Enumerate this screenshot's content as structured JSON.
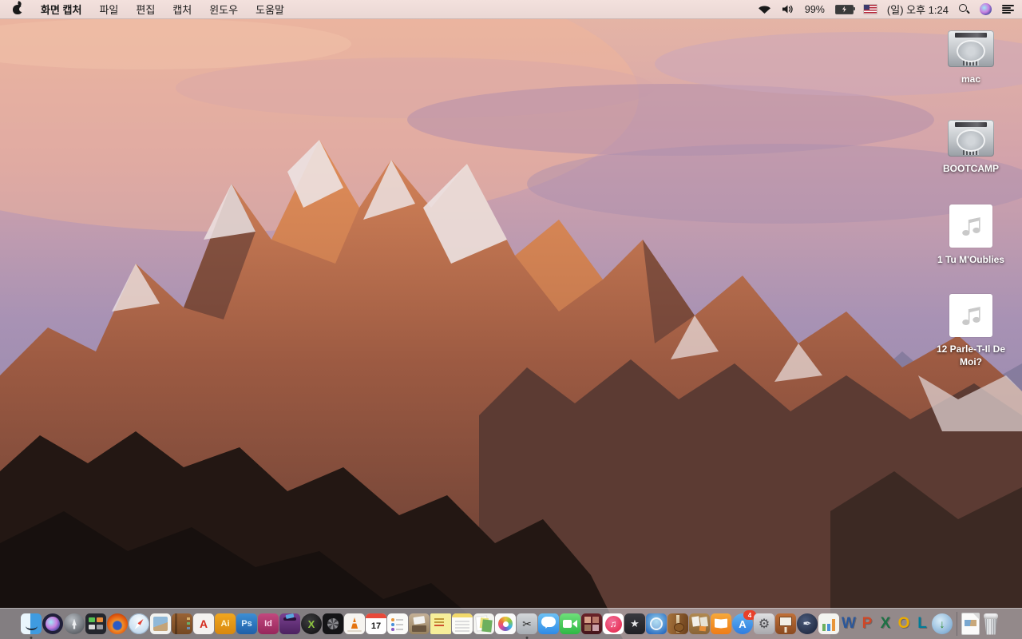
{
  "menu_bar": {
    "app_menu": "화면 캡처",
    "menus": [
      "파일",
      "편집",
      "캡처",
      "윈도우",
      "도움말"
    ],
    "status": {
      "battery_percent": "99%",
      "clock": "(일) 오후 1:24"
    }
  },
  "desktop": {
    "icons": [
      {
        "label": "mac",
        "type": "hard-drive"
      },
      {
        "label": "BOOTCAMP",
        "type": "hard-drive"
      },
      {
        "label": "1 Tu M'Oublies",
        "type": "audio-file"
      },
      {
        "label": "12 Parle-T-Il De Moi?",
        "type": "audio-file"
      }
    ]
  },
  "dock": {
    "apps": [
      "finder",
      "siri",
      "launchpad",
      "mission-control",
      "firefox",
      "safari",
      "preview",
      "contacts",
      "adobe-acrobat",
      "adobe-illustrator",
      "adobe-photoshop",
      "adobe-indesign",
      "toast-titanium",
      "x-utility",
      "disk-utility",
      "vlc",
      "calendar",
      "reminders",
      "document-inbox",
      "stickies",
      "notes",
      "iwork-documents",
      "photos",
      "grab-screen-capture",
      "messages",
      "facetime",
      "photo-booth",
      "itunes",
      "imovie",
      "idvd",
      "garageband",
      "corkboard-kit",
      "ibooks",
      "app-store",
      "system-preferences",
      "keynote",
      "pages",
      "numbers",
      "ms-word",
      "ms-powerpoint",
      "ms-excel",
      "ms-outlook",
      "ms-lync",
      "web-downloader",
      "document-file",
      "trash"
    ],
    "running": [
      "finder",
      "grab-screen-capture"
    ],
    "glyphs": {
      "acrobat": "A",
      "illustrator": "Ai",
      "photoshop": "Ps",
      "indesign": "Id",
      "x_utility": "X",
      "calendar_day": "17",
      "grab": "✂",
      "itunes": "♫",
      "imovie": "★",
      "app_store": "A",
      "app_store_badge": "4",
      "system_prefs": "⚙",
      "pages": "✒",
      "word": "W",
      "powerpoint": "P",
      "excel": "X",
      "outlook": "O",
      "lync": "L",
      "downloader": "↓"
    }
  },
  "colors": {
    "menu_bar_bg": "#efdcd8",
    "dock_bg": "rgba(211,207,214,0.58)",
    "sky_top": "#e7b6a4",
    "sky_bottom": "#8e85ab",
    "mountain_sunlit": "#d8865a",
    "mountain_shadow": "#5e3a32",
    "foreground_rock": "#231713",
    "label_text": "#ffffff"
  }
}
